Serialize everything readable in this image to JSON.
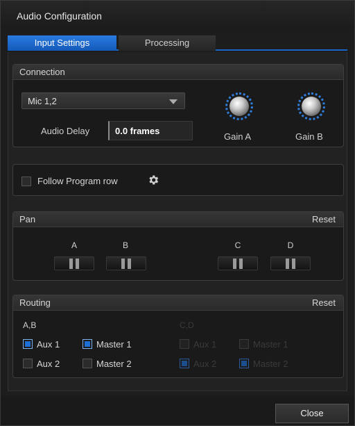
{
  "window": {
    "title": "Audio Configuration"
  },
  "tabs": [
    {
      "label": "Input Settings",
      "active": true
    },
    {
      "label": "Processing",
      "active": false
    }
  ],
  "connection": {
    "header": "Connection",
    "source": "Mic 1,2",
    "audio_delay_label": "Audio Delay",
    "audio_delay_value": "0.0 frames",
    "gain_a_label": "Gain A",
    "gain_b_label": "Gain B"
  },
  "follow": {
    "label": "Follow Program row",
    "checked": false,
    "icon": "gear-icon"
  },
  "pan": {
    "header": "Pan",
    "reset": "Reset",
    "channels": [
      {
        "label": "A",
        "position": 0.5
      },
      {
        "label": "B",
        "position": 0.5
      },
      {
        "label": "C",
        "position": 0.5
      },
      {
        "label": "D",
        "position": 0.5
      }
    ]
  },
  "routing": {
    "header": "Routing",
    "reset": "Reset",
    "group_ab": {
      "label": "A,B",
      "aux1": {
        "label": "Aux 1",
        "checked": true
      },
      "aux2": {
        "label": "Aux 2",
        "checked": false
      },
      "master1": {
        "label": "Master 1",
        "checked": true
      },
      "master2": {
        "label": "Master 2",
        "checked": false
      }
    },
    "group_cd": {
      "label": "C,D",
      "aux1": {
        "label": "Aux 1",
        "checked": false
      },
      "aux2": {
        "label": "Aux 2",
        "checked": true
      },
      "master1": {
        "label": "Master 1",
        "checked": false
      },
      "master2": {
        "label": "Master 2",
        "checked": true
      }
    }
  },
  "footer": {
    "close_label": "Close"
  },
  "colors": {
    "accent": "#1d6fd6",
    "background": "#1d1d1d"
  }
}
